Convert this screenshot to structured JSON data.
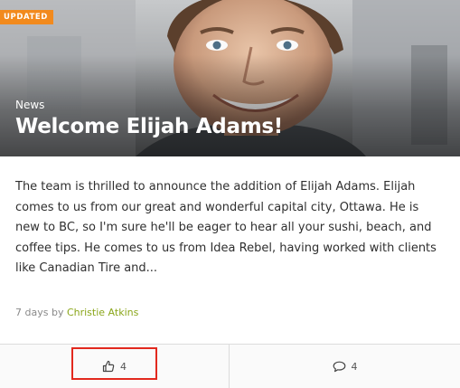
{
  "card": {
    "badge": "UPDATED",
    "category": "News",
    "title": "Welcome Elijah Adams!",
    "excerpt": "The team is thrilled to announce the addition of Elijah Adams. Elijah comes to us from our great and wonderful capital city, Ottawa. He is new to BC, so I'm sure he'll be eager to hear all your sushi, beach, and coffee tips. He comes to us from Idea Rebel, having worked with clients like Canadian Tire and...",
    "meta_time": "7 days by",
    "author": "Christie Atkins"
  },
  "footer": {
    "like_count": "4",
    "comment_count": "4",
    "like_icon": "thumbs-up-icon",
    "comment_icon": "speech-bubble-icon"
  },
  "colors": {
    "badge": "#f28a1d",
    "author_link": "#8aa61a",
    "highlight_box": "#e2291e"
  }
}
